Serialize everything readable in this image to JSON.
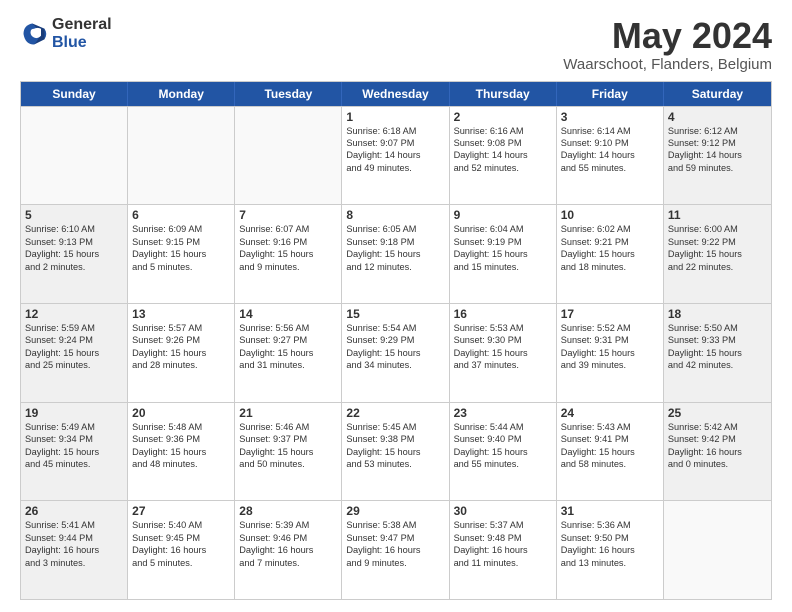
{
  "logo": {
    "general": "General",
    "blue": "Blue"
  },
  "header": {
    "title": "May 2024",
    "subtitle": "Waarschoot, Flanders, Belgium"
  },
  "days_of_week": [
    "Sunday",
    "Monday",
    "Tuesday",
    "Wednesday",
    "Thursday",
    "Friday",
    "Saturday"
  ],
  "weeks": [
    [
      {
        "day": "",
        "lines": [],
        "empty": true
      },
      {
        "day": "",
        "lines": [],
        "empty": true
      },
      {
        "day": "",
        "lines": [],
        "empty": true
      },
      {
        "day": "1",
        "lines": [
          "Sunrise: 6:18 AM",
          "Sunset: 9:07 PM",
          "Daylight: 14 hours",
          "and 49 minutes."
        ],
        "empty": false
      },
      {
        "day": "2",
        "lines": [
          "Sunrise: 6:16 AM",
          "Sunset: 9:08 PM",
          "Daylight: 14 hours",
          "and 52 minutes."
        ],
        "empty": false
      },
      {
        "day": "3",
        "lines": [
          "Sunrise: 6:14 AM",
          "Sunset: 9:10 PM",
          "Daylight: 14 hours",
          "and 55 minutes."
        ],
        "empty": false
      },
      {
        "day": "4",
        "lines": [
          "Sunrise: 6:12 AM",
          "Sunset: 9:12 PM",
          "Daylight: 14 hours",
          "and 59 minutes."
        ],
        "empty": false
      }
    ],
    [
      {
        "day": "5",
        "lines": [
          "Sunrise: 6:10 AM",
          "Sunset: 9:13 PM",
          "Daylight: 15 hours",
          "and 2 minutes."
        ],
        "empty": false
      },
      {
        "day": "6",
        "lines": [
          "Sunrise: 6:09 AM",
          "Sunset: 9:15 PM",
          "Daylight: 15 hours",
          "and 5 minutes."
        ],
        "empty": false
      },
      {
        "day": "7",
        "lines": [
          "Sunrise: 6:07 AM",
          "Sunset: 9:16 PM",
          "Daylight: 15 hours",
          "and 9 minutes."
        ],
        "empty": false
      },
      {
        "day": "8",
        "lines": [
          "Sunrise: 6:05 AM",
          "Sunset: 9:18 PM",
          "Daylight: 15 hours",
          "and 12 minutes."
        ],
        "empty": false
      },
      {
        "day": "9",
        "lines": [
          "Sunrise: 6:04 AM",
          "Sunset: 9:19 PM",
          "Daylight: 15 hours",
          "and 15 minutes."
        ],
        "empty": false
      },
      {
        "day": "10",
        "lines": [
          "Sunrise: 6:02 AM",
          "Sunset: 9:21 PM",
          "Daylight: 15 hours",
          "and 18 minutes."
        ],
        "empty": false
      },
      {
        "day": "11",
        "lines": [
          "Sunrise: 6:00 AM",
          "Sunset: 9:22 PM",
          "Daylight: 15 hours",
          "and 22 minutes."
        ],
        "empty": false
      }
    ],
    [
      {
        "day": "12",
        "lines": [
          "Sunrise: 5:59 AM",
          "Sunset: 9:24 PM",
          "Daylight: 15 hours",
          "and 25 minutes."
        ],
        "empty": false
      },
      {
        "day": "13",
        "lines": [
          "Sunrise: 5:57 AM",
          "Sunset: 9:26 PM",
          "Daylight: 15 hours",
          "and 28 minutes."
        ],
        "empty": false
      },
      {
        "day": "14",
        "lines": [
          "Sunrise: 5:56 AM",
          "Sunset: 9:27 PM",
          "Daylight: 15 hours",
          "and 31 minutes."
        ],
        "empty": false
      },
      {
        "day": "15",
        "lines": [
          "Sunrise: 5:54 AM",
          "Sunset: 9:29 PM",
          "Daylight: 15 hours",
          "and 34 minutes."
        ],
        "empty": false
      },
      {
        "day": "16",
        "lines": [
          "Sunrise: 5:53 AM",
          "Sunset: 9:30 PM",
          "Daylight: 15 hours",
          "and 37 minutes."
        ],
        "empty": false
      },
      {
        "day": "17",
        "lines": [
          "Sunrise: 5:52 AM",
          "Sunset: 9:31 PM",
          "Daylight: 15 hours",
          "and 39 minutes."
        ],
        "empty": false
      },
      {
        "day": "18",
        "lines": [
          "Sunrise: 5:50 AM",
          "Sunset: 9:33 PM",
          "Daylight: 15 hours",
          "and 42 minutes."
        ],
        "empty": false
      }
    ],
    [
      {
        "day": "19",
        "lines": [
          "Sunrise: 5:49 AM",
          "Sunset: 9:34 PM",
          "Daylight: 15 hours",
          "and 45 minutes."
        ],
        "empty": false
      },
      {
        "day": "20",
        "lines": [
          "Sunrise: 5:48 AM",
          "Sunset: 9:36 PM",
          "Daylight: 15 hours",
          "and 48 minutes."
        ],
        "empty": false
      },
      {
        "day": "21",
        "lines": [
          "Sunrise: 5:46 AM",
          "Sunset: 9:37 PM",
          "Daylight: 15 hours",
          "and 50 minutes."
        ],
        "empty": false
      },
      {
        "day": "22",
        "lines": [
          "Sunrise: 5:45 AM",
          "Sunset: 9:38 PM",
          "Daylight: 15 hours",
          "and 53 minutes."
        ],
        "empty": false
      },
      {
        "day": "23",
        "lines": [
          "Sunrise: 5:44 AM",
          "Sunset: 9:40 PM",
          "Daylight: 15 hours",
          "and 55 minutes."
        ],
        "empty": false
      },
      {
        "day": "24",
        "lines": [
          "Sunrise: 5:43 AM",
          "Sunset: 9:41 PM",
          "Daylight: 15 hours",
          "and 58 minutes."
        ],
        "empty": false
      },
      {
        "day": "25",
        "lines": [
          "Sunrise: 5:42 AM",
          "Sunset: 9:42 PM",
          "Daylight: 16 hours",
          "and 0 minutes."
        ],
        "empty": false
      }
    ],
    [
      {
        "day": "26",
        "lines": [
          "Sunrise: 5:41 AM",
          "Sunset: 9:44 PM",
          "Daylight: 16 hours",
          "and 3 minutes."
        ],
        "empty": false
      },
      {
        "day": "27",
        "lines": [
          "Sunrise: 5:40 AM",
          "Sunset: 9:45 PM",
          "Daylight: 16 hours",
          "and 5 minutes."
        ],
        "empty": false
      },
      {
        "day": "28",
        "lines": [
          "Sunrise: 5:39 AM",
          "Sunset: 9:46 PM",
          "Daylight: 16 hours",
          "and 7 minutes."
        ],
        "empty": false
      },
      {
        "day": "29",
        "lines": [
          "Sunrise: 5:38 AM",
          "Sunset: 9:47 PM",
          "Daylight: 16 hours",
          "and 9 minutes."
        ],
        "empty": false
      },
      {
        "day": "30",
        "lines": [
          "Sunrise: 5:37 AM",
          "Sunset: 9:48 PM",
          "Daylight: 16 hours",
          "and 11 minutes."
        ],
        "empty": false
      },
      {
        "day": "31",
        "lines": [
          "Sunrise: 5:36 AM",
          "Sunset: 9:50 PM",
          "Daylight: 16 hours",
          "and 13 minutes."
        ],
        "empty": false
      },
      {
        "day": "",
        "lines": [],
        "empty": true
      }
    ]
  ]
}
